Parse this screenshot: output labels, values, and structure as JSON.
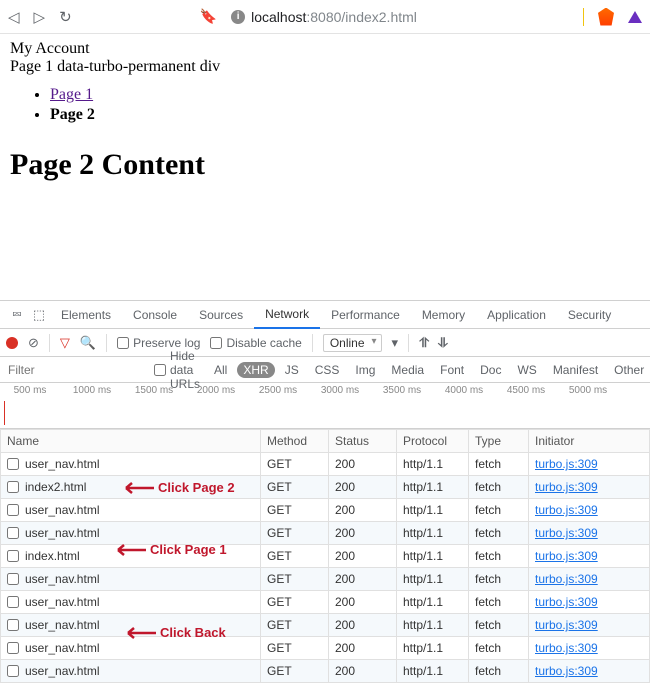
{
  "browser": {
    "url_host_main": "localhost",
    "url_host_rest": ":8080/index2.html"
  },
  "page": {
    "line1": "My Account",
    "line2": "Page 1 data-turbo-permanent div",
    "link_page1": "Page 1",
    "link_page2": "Page 2",
    "heading": "Page 2 Content"
  },
  "devtools": {
    "tabs": [
      "Elements",
      "Console",
      "Sources",
      "Network",
      "Performance",
      "Memory",
      "Application",
      "Security"
    ],
    "active_tab": "Network",
    "toolbar": {
      "preserve_log": "Preserve log",
      "disable_cache": "Disable cache",
      "throttle": "Online"
    },
    "filter": {
      "placeholder": "Filter",
      "hide_data_urls": "Hide data URLs",
      "types": [
        "All",
        "XHR",
        "JS",
        "CSS",
        "Img",
        "Media",
        "Font",
        "Doc",
        "WS",
        "Manifest",
        "Other"
      ],
      "active_type": "XHR"
    },
    "timeline_ticks": [
      "500 ms",
      "1000 ms",
      "1500 ms",
      "2000 ms",
      "2500 ms",
      "3000 ms",
      "3500 ms",
      "4000 ms",
      "4500 ms",
      "5000 ms"
    ],
    "columns": [
      "Name",
      "Method",
      "Status",
      "Protocol",
      "Type",
      "Initiator"
    ],
    "rows": [
      {
        "name": "user_nav.html",
        "method": "GET",
        "status": "200",
        "protocol": "http/1.1",
        "type": "fetch",
        "initiator": "turbo.js:309"
      },
      {
        "name": "index2.html",
        "method": "GET",
        "status": "200",
        "protocol": "http/1.1",
        "type": "fetch",
        "initiator": "turbo.js:309"
      },
      {
        "name": "user_nav.html",
        "method": "GET",
        "status": "200",
        "protocol": "http/1.1",
        "type": "fetch",
        "initiator": "turbo.js:309"
      },
      {
        "name": "user_nav.html",
        "method": "GET",
        "status": "200",
        "protocol": "http/1.1",
        "type": "fetch",
        "initiator": "turbo.js:309"
      },
      {
        "name": "index.html",
        "method": "GET",
        "status": "200",
        "protocol": "http/1.1",
        "type": "fetch",
        "initiator": "turbo.js:309"
      },
      {
        "name": "user_nav.html",
        "method": "GET",
        "status": "200",
        "protocol": "http/1.1",
        "type": "fetch",
        "initiator": "turbo.js:309"
      },
      {
        "name": "user_nav.html",
        "method": "GET",
        "status": "200",
        "protocol": "http/1.1",
        "type": "fetch",
        "initiator": "turbo.js:309"
      },
      {
        "name": "user_nav.html",
        "method": "GET",
        "status": "200",
        "protocol": "http/1.1",
        "type": "fetch",
        "initiator": "turbo.js:309"
      },
      {
        "name": "user_nav.html",
        "method": "GET",
        "status": "200",
        "protocol": "http/1.1",
        "type": "fetch",
        "initiator": "turbo.js:309"
      },
      {
        "name": "user_nav.html",
        "method": "GET",
        "status": "200",
        "protocol": "http/1.1",
        "type": "fetch",
        "initiator": "turbo.js:309"
      }
    ]
  },
  "annotations": {
    "a1": "Click Page 2",
    "a2": "Click Page 1",
    "a3": "Click Back"
  }
}
